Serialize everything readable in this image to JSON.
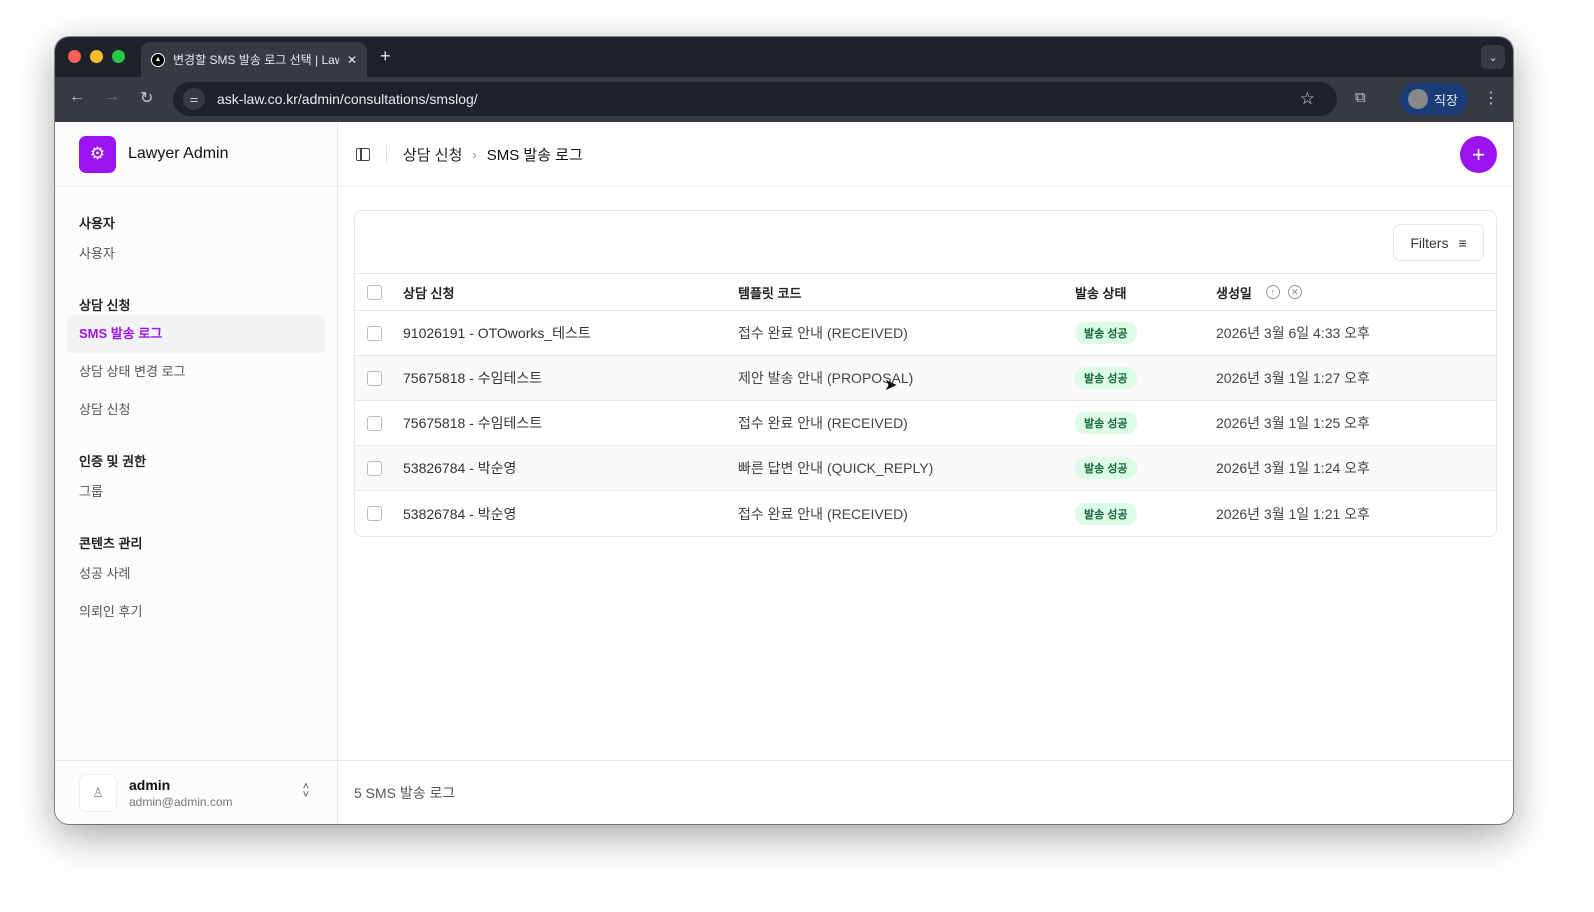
{
  "browser": {
    "tab_title": "변경할 SMS 발송 로그 선택 | Lawyer Admin",
    "url": "ask-law.co.kr/admin/consultations/smslog/",
    "profile": "직장"
  },
  "sidebar": {
    "brand": "Lawyer Admin",
    "groups": [
      {
        "label": "사용자",
        "items": [
          {
            "label": "사용자"
          }
        ]
      },
      {
        "label": "상담 신청",
        "items": [
          {
            "label": "SMS 발송 로그",
            "active": true
          },
          {
            "label": "상담 상태 변경 로그"
          },
          {
            "label": "상담 신청"
          }
        ]
      },
      {
        "label": "인증 및 권한",
        "items": [
          {
            "label": "그룹"
          }
        ]
      },
      {
        "label": "콘텐츠 관리",
        "items": [
          {
            "label": "성공 사례"
          },
          {
            "label": "의뢰인 후기"
          }
        ]
      }
    ],
    "user": {
      "name": "admin",
      "email": "admin@admin.com"
    }
  },
  "header": {
    "breadcrumb": [
      "상담 신청",
      "SMS 발송 로그"
    ]
  },
  "table": {
    "filters_label": "Filters",
    "columns": [
      "상담 신청",
      "템플릿 코드",
      "발송 상태",
      "생성일"
    ],
    "rows": [
      [
        "91026191 - OTOworks_테스트",
        "접수 완료 안내 (RECEIVED)",
        "발송 성공",
        "2026년 3월 6일 4:33 오후"
      ],
      [
        "75675818 - 수임테스트",
        "제안 발송 안내 (PROPOSAL)",
        "발송 성공",
        "2026년 3월 1일 1:27 오후"
      ],
      [
        "75675818 - 수임테스트",
        "접수 완료 안내 (RECEIVED)",
        "발송 성공",
        "2026년 3월 1일 1:25 오후"
      ],
      [
        "53826784 - 박순영",
        "빠른 답변 안내 (QUICK_REPLY)",
        "발송 성공",
        "2026년 3월 1일 1:24 오후"
      ],
      [
        "53826784 - 박순영",
        "접수 완료 안내 (RECEIVED)",
        "발송 성공",
        "2026년 3월 1일 1:21 오후"
      ]
    ]
  },
  "footer": {
    "count_text": "5 SMS 발송 로그"
  },
  "colors": {
    "accent": "#9b14f0",
    "badge_bg": "#dcfce7",
    "badge_text": "#166534"
  }
}
